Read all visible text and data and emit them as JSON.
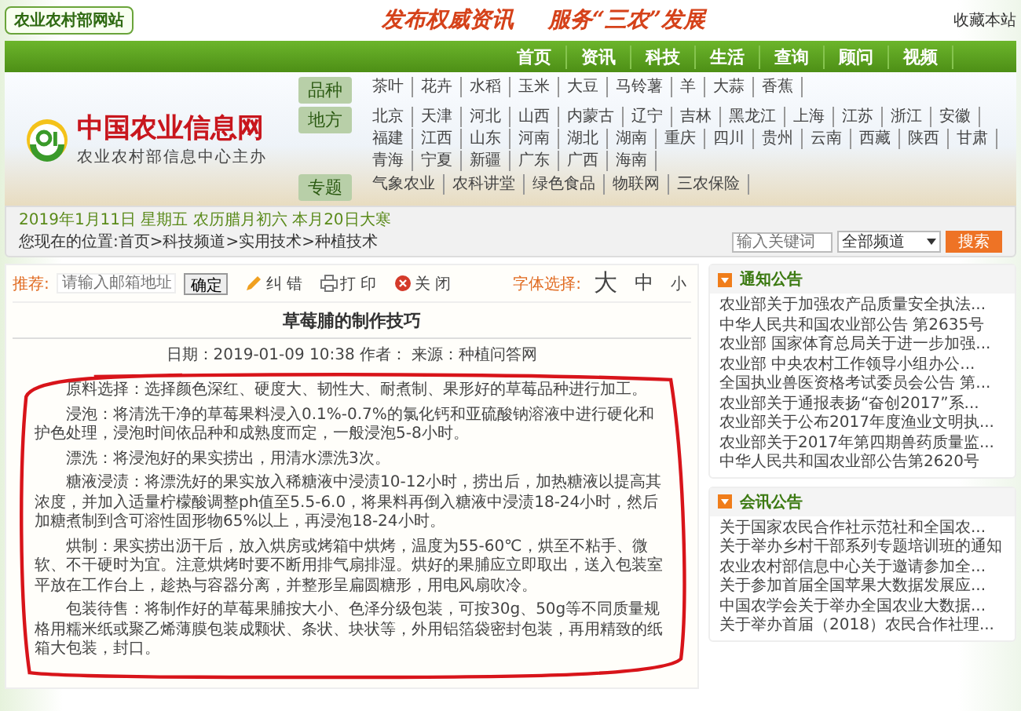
{
  "header": {
    "site_badge": "农业农村部网站",
    "slogan": [
      "发布权威资讯",
      "服务“三农”发展"
    ],
    "bookmark_link": "收藏本站"
  },
  "nav": {
    "items": [
      "首页",
      "资讯",
      "科技",
      "生活",
      "查询",
      "顾问",
      "视频"
    ]
  },
  "banner": {
    "logo_title": "中国农业信息网",
    "logo_subtitle": "农业农村部信息中心主办",
    "category_groups": [
      {
        "label": "品种",
        "items": [
          "茶叶",
          "花卉",
          "水稻",
          "玉米",
          "大豆",
          "马铃薯",
          "羊",
          "大蒜",
          "香蕉"
        ]
      },
      {
        "label": "地方",
        "items": [
          "北京",
          "天津",
          "河北",
          "山西",
          "内蒙古",
          "辽宁",
          "吉林",
          "黑龙江",
          "上海",
          "江苏",
          "浙江",
          "安徽",
          "福建",
          "江西",
          "山东",
          "河南",
          "湖北",
          "湖南",
          "重庆",
          "四川",
          "贵州",
          "云南",
          "西藏",
          "陕西",
          "甘肃",
          "青海",
          "宁夏",
          "新疆",
          "广东",
          "广西",
          "海南"
        ]
      },
      {
        "label": "专题",
        "items": [
          "气象农业",
          "农科讲堂",
          "绿色食品",
          "物联网",
          "三农保险"
        ]
      }
    ]
  },
  "info_bar": {
    "date": "2019年1月11日 星期五 农历腊月初六 本月20日大寒",
    "breadcrumb": "您现在的位置:首页>科技频道>实用技术>种植技术",
    "search": {
      "placeholder": "输入关键词",
      "channel": "全部频道",
      "button": "搜索"
    }
  },
  "article": {
    "toolbar": {
      "recommend_label": "推荐:",
      "email_placeholder": "请输入邮箱地址",
      "confirm_button": "确定",
      "actions": [
        {
          "kind": "correct",
          "label": "纠 错"
        },
        {
          "kind": "print",
          "label": "打 印"
        },
        {
          "kind": "close",
          "label": "关 闭"
        }
      ],
      "font_label": "字体选择:",
      "font_sizes": [
        "大",
        "中",
        "小"
      ]
    },
    "title": "草莓脯的制作技巧",
    "meta": "日期：2019-01-09 10:38 作者： 来源：种植问答网",
    "paragraphs": [
      "原料选择：选择颜色深红、硬度大、韧性大、耐煮制、果形好的草莓品种进行加工。",
      "浸泡：将清洗干净的草莓果料浸入0.1%-0.7%的氯化钙和亚硫酸钠溶液中进行硬化和护色处理，浸泡时间依品种和成熟度而定，一般浸泡5-8小时。",
      "漂洗：将浸泡好的果实捞出，用清水漂洗3次。",
      "糖液浸渍：将漂洗好的果实放入稀糖液中浸渍10-12小时，捞出后，加热糖液以提高其浓度，并加入适量柠檬酸调整ph值至5.5-6.0，将果料再倒入糖液中浸渍18-24小时，然后加糖煮制到含可溶性固形物65%以上，再浸泡18-24小时。",
      "烘制：果实捞出沥干后，放入烘房或烤箱中烘烤，温度为55-60℃，烘至不粘手、微软、不干硬时为宜。注意烘烤时要不断用排气扇排湿。烘好的果脯应立即取出，送入包装室平放在工作台上，趁热与容器分离，并整形呈扁圆糖形，用电风扇吹冷。",
      "包装待售：将制作好的草莓果脯按大小、色泽分级包装，可按30g、50g等不同质量规格用糯米纸或聚乙烯薄膜包装成颗状、条状、块状等，外用铝箔袋密封包装，再用精致的纸箱大包装，封口。"
    ]
  },
  "sidebar": {
    "panels": [
      {
        "title": "通知公告",
        "items": [
          "农业部关于加强农产品质量安全执法...",
          "中华人民共和国农业部公告 第2635号",
          "农业部 国家体育总局关于进一步加强...",
          "农业部 中央农村工作领导小组办公...",
          "全国执业兽医资格考试委员会公告 第...",
          "农业部关于通报表扬“奋创2017”系...",
          "农业部关于公布2017年度渔业文明执...",
          "农业部关于2017年第四期兽药质量监...",
          "中华人民共和国农业部公告第2620号"
        ]
      },
      {
        "title": "会讯公告",
        "items": [
          "关于国家农民合作社示范社和全国农...",
          "关于举办乡村干部系列专题培训班的通知",
          "农业农村部信息中心关于邀请参加全...",
          "关于参加首届全国苹果大数据发展应...",
          "中国农学会关于举办全国农业大数据...",
          "关于举办首届（2018）农民合作社理..."
        ]
      }
    ]
  }
}
